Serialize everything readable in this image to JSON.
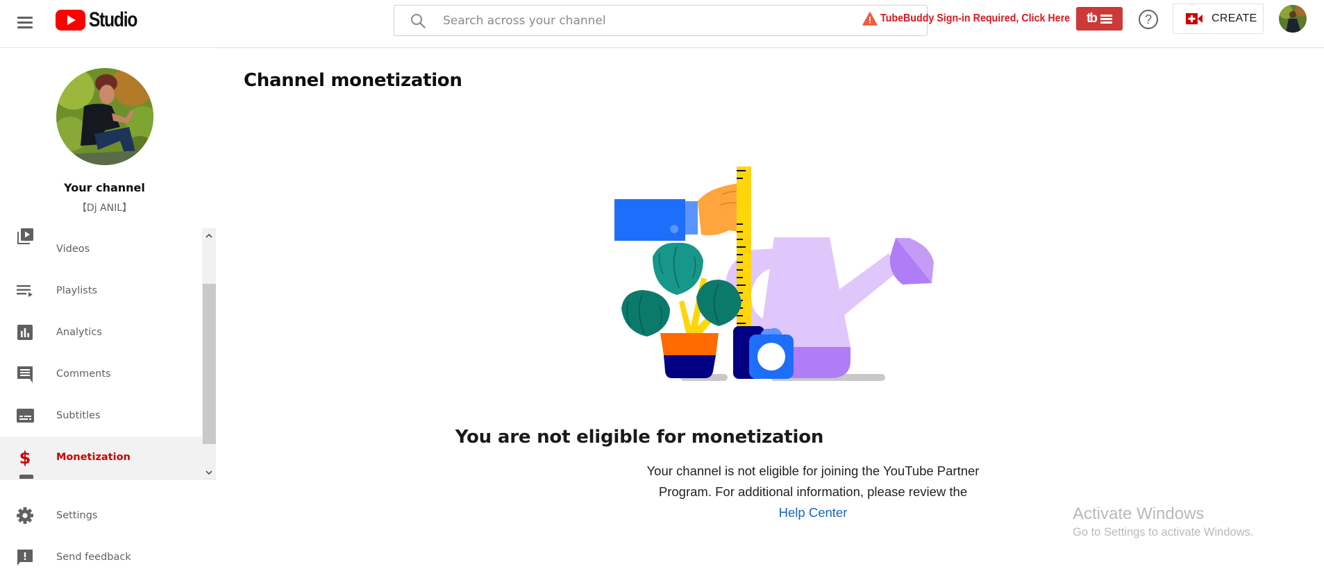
{
  "header": {
    "menu_icon": "hamburger-menu-icon",
    "logo_text": "Studio",
    "search_placeholder": "Search across your channel",
    "search_value": "",
    "tubebuddy_warning": "TubeBuddy Sign-in Required, Click Here",
    "tubebuddy_logo": "tb",
    "help_icon": "question-circle-icon",
    "create_label": "CREATE",
    "colors": {
      "brand_red": "#ff0000",
      "warning_red": "#d9181f",
      "tubebuddy_bg": "#cb3a37"
    }
  },
  "sidebar": {
    "channel_title": "Your channel",
    "channel_name": "【Dj ANIL】",
    "nav_items": [
      {
        "label": "Videos",
        "icon": "videos-icon",
        "active": false
      },
      {
        "label": "Playlists",
        "icon": "playlists-icon",
        "active": false
      },
      {
        "label": "Analytics",
        "icon": "analytics-icon",
        "active": false
      },
      {
        "label": "Comments",
        "icon": "comments-icon",
        "active": false
      },
      {
        "label": "Subtitles",
        "icon": "subtitles-icon",
        "active": false
      },
      {
        "label": "Monetization",
        "icon": "dollar-icon",
        "active": true
      }
    ],
    "bottom_items": [
      {
        "label": "Settings",
        "icon": "gear-icon"
      },
      {
        "label": "Send feedback",
        "icon": "feedback-icon"
      }
    ],
    "active_color": "#cc0000"
  },
  "main": {
    "page_title": "Channel monetization",
    "illustration": "measuring-plant-watering-can-illustration",
    "empty_title": "You are not eligible for monetization",
    "empty_desc_line1": "Your channel is not eligible for joining the YouTube Partner",
    "empty_desc_line2": "Program. For additional information, please review the",
    "help_link": "Help Center",
    "link_color": "#1a63c5"
  },
  "watermark": {
    "title": "Activate Windows",
    "subtitle": "Go to Settings to activate Windows."
  }
}
